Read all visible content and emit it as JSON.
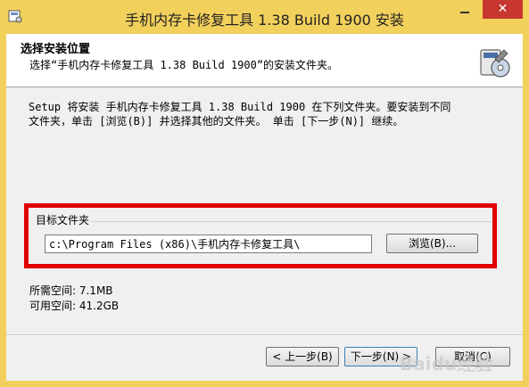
{
  "window": {
    "title": "手机内存卡修复工具 1.38 Build 1900 安装",
    "close_glyph": "✕",
    "title_bar_color": "#f2d05c",
    "close_color": "#c7372f"
  },
  "header": {
    "title": "选择安装位置",
    "subtitle": "选择“手机内存卡修复工具 1.38 Build 1900”的安装文件夹。"
  },
  "content": {
    "description_line1": "Setup 将安装 手机内存卡修复工具 1.38 Build 1900 在下列文件夹。要安装到不同",
    "description_line2": "文件夹，单击 [浏览(B)] 并选择其他的文件夹。 单击 [下一步(N)] 继续。"
  },
  "target_folder": {
    "group_label": "目标文件夹",
    "path_value": "c:\\Program Files (x86)\\手机内存卡修复工具\\",
    "browse_label": "浏览(B)...",
    "highlight_color": "#e00000"
  },
  "space": {
    "required": "所需空间: 7.1MB",
    "available": "可用空间: 41.2GB"
  },
  "buttons": {
    "back": "< 上一步(B)",
    "next": "下一步(N) >",
    "cancel": "取消(C)"
  },
  "watermark": "Baidu经验"
}
